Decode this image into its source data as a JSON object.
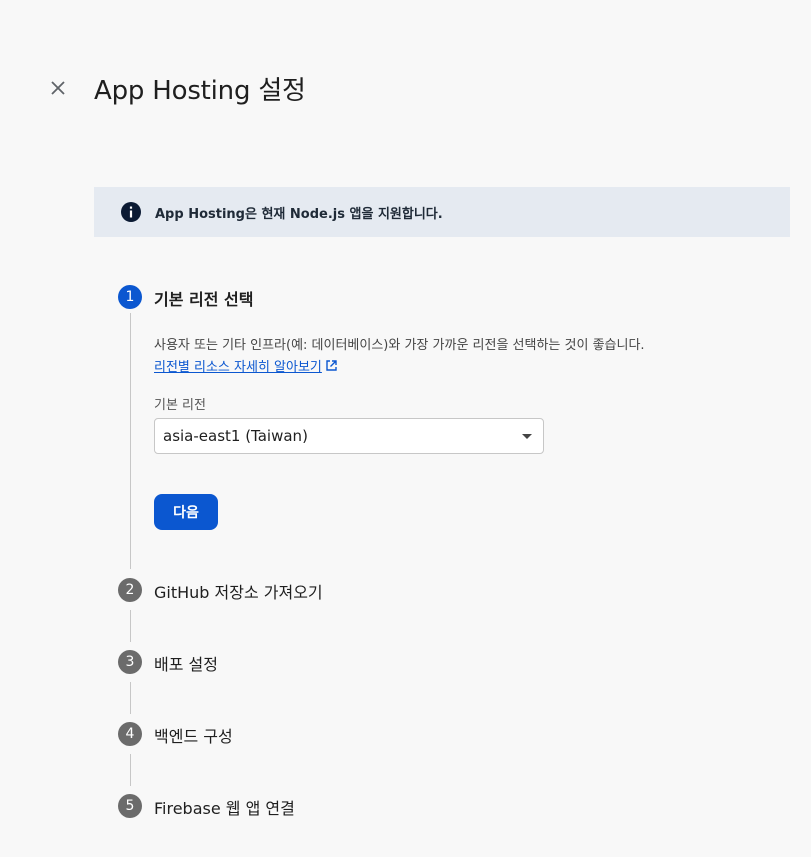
{
  "header": {
    "title": "App Hosting 설정",
    "close_icon": "close-icon"
  },
  "banner": {
    "icon": "info-icon",
    "text": "App Hosting은 현재 Node.js 앱을 지원합니다."
  },
  "steps": [
    {
      "number": "1",
      "title": "기본 리전 선택",
      "state": "active",
      "description": "사용자 또는 기타 인프라(예: 데이터베이스)와 가장 가까운 리전을 선택하는 것이 좋습니다.",
      "link_text": "리전별 리소스 자세히 알아보기",
      "field_label": "기본 리전",
      "selected_region": "asia-east1 (Taiwan)",
      "next_button": "다음"
    },
    {
      "number": "2",
      "title": "GitHub 저장소 가져오기",
      "state": "inactive"
    },
    {
      "number": "3",
      "title": "배포 설정",
      "state": "inactive"
    },
    {
      "number": "4",
      "title": "백엔드 구성",
      "state": "inactive"
    },
    {
      "number": "5",
      "title": "Firebase 웹 앱 연결",
      "state": "inactive"
    }
  ],
  "colors": {
    "accent": "#0b57d0",
    "inactive_step": "#6b6b6b",
    "banner_bg": "#e5eaf1",
    "background": "#f8f8f8"
  }
}
